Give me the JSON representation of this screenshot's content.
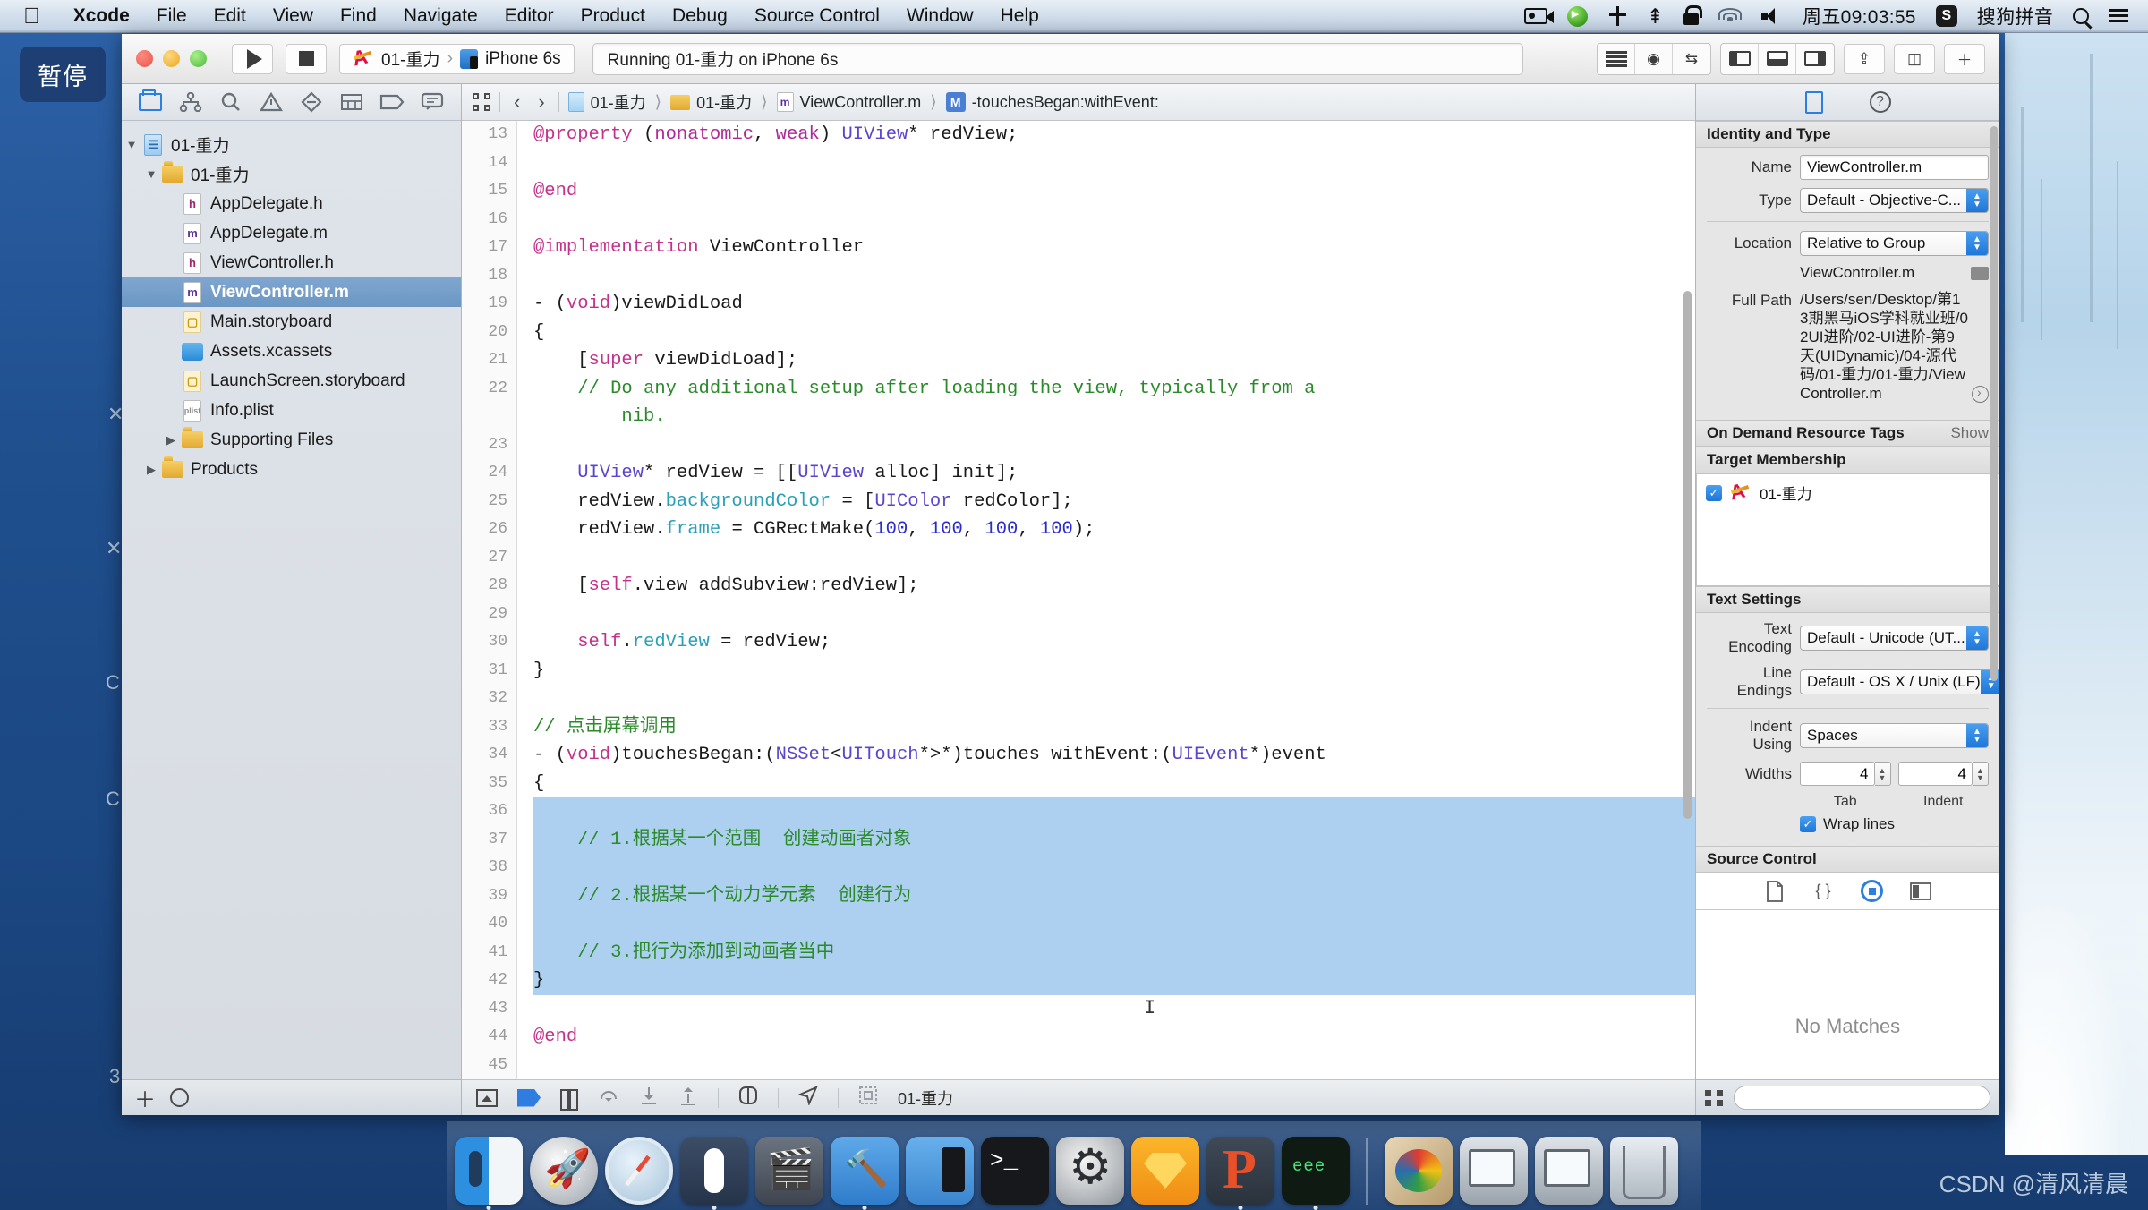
{
  "menubar": {
    "apple_icon": "apple-logo",
    "items": [
      {
        "label": "Xcode",
        "bold": true
      },
      {
        "label": "File",
        "bold": false
      },
      {
        "label": "Edit",
        "bold": false
      },
      {
        "label": "View",
        "bold": false
      },
      {
        "label": "Find",
        "bold": false
      },
      {
        "label": "Navigate",
        "bold": false
      },
      {
        "label": "Editor",
        "bold": false
      },
      {
        "label": "Product",
        "bold": false
      },
      {
        "label": "Debug",
        "bold": false
      },
      {
        "label": "Source Control",
        "bold": false
      },
      {
        "label": "Window",
        "bold": false
      },
      {
        "label": "Help",
        "bold": false
      }
    ],
    "status_icons": [
      "screen-record-icon",
      "green-play-icon",
      "time-machine-icon",
      "bluetooth-icon",
      "lock-icon",
      "wifi-icon",
      "volume-icon"
    ],
    "clock": "周五09:03:55",
    "ime_badge": "S",
    "ime_label": "搜狗拼音",
    "search_icon": "spotlight-search-icon",
    "list_icon": "notification-center-icon"
  },
  "overlay": {
    "pause_label": "暂停"
  },
  "toolbar": {
    "run_icon": "run-play-icon",
    "stop_icon": "stop-square-icon",
    "scheme_project": "01-重力",
    "scheme_separator": "›",
    "scheme_device": "iPhone 6s",
    "activity_status": "Running 01-重力 on iPhone 6s",
    "right_icons": [
      "standard-editor-icon",
      "assistant-editor-icon",
      "version-editor-icon",
      "navigator-panel-icon",
      "debug-panel-icon",
      "utilities-panel-icon",
      "share-icon",
      "organizer-icon",
      "add-icon"
    ]
  },
  "navigator": {
    "tabs": [
      "project-navigator-icon",
      "symbol-navigator-icon",
      "find-navigator-icon",
      "issue-navigator-icon",
      "test-navigator-icon",
      "debug-navigator-icon",
      "breakpoint-navigator-icon",
      "report-navigator-icon"
    ],
    "tree": [
      {
        "label": "01-重力",
        "indent": 0,
        "disclosure": "▼",
        "icon": "project-icon",
        "selected": false
      },
      {
        "label": "01-重力",
        "indent": 1,
        "disclosure": "▼",
        "icon": "folder-icon",
        "selected": false
      },
      {
        "label": "AppDelegate.h",
        "indent": 2,
        "disclosure": "",
        "icon": "header-file-icon",
        "selected": false
      },
      {
        "label": "AppDelegate.m",
        "indent": 2,
        "disclosure": "",
        "icon": "objc-file-icon",
        "selected": false
      },
      {
        "label": "ViewController.h",
        "indent": 2,
        "disclosure": "",
        "icon": "header-file-icon",
        "selected": false
      },
      {
        "label": "ViewController.m",
        "indent": 2,
        "disclosure": "",
        "icon": "objc-file-icon",
        "selected": true
      },
      {
        "label": "Main.storyboard",
        "indent": 2,
        "disclosure": "",
        "icon": "storyboard-icon",
        "selected": false
      },
      {
        "label": "Assets.xcassets",
        "indent": 2,
        "disclosure": "",
        "icon": "xcassets-icon",
        "selected": false
      },
      {
        "label": "LaunchScreen.storyboard",
        "indent": 2,
        "disclosure": "",
        "icon": "storyboard-icon",
        "selected": false
      },
      {
        "label": "Info.plist",
        "indent": 2,
        "disclosure": "",
        "icon": "plist-icon",
        "selected": false
      },
      {
        "label": "Supporting Files",
        "indent": 1,
        "disclosure": "▶",
        "icon": "folder-icon",
        "selected": false
      },
      {
        "label": "Products",
        "indent": 0,
        "disclosure": "▶",
        "icon": "folder-icon",
        "selected": false
      }
    ],
    "bottom_icons": [
      "add-file-icon",
      "filter-icon"
    ]
  },
  "jumpbar": {
    "grid_icon": "related-items-icon",
    "back_label": "‹",
    "forward_label": "›",
    "crumbs": [
      {
        "label": "01-重力",
        "icon": "project-icon"
      },
      {
        "label": "01-重力",
        "icon": "folder-icon"
      },
      {
        "label": "ViewController.m",
        "icon": "objc-file-icon"
      },
      {
        "label": "-touchesBegan:withEvent:",
        "icon": "method-icon"
      }
    ]
  },
  "editor": {
    "first_line": 13,
    "lines": [
      {
        "n": 13,
        "tokens": [
          {
            "t": "@property",
            "c": "kw"
          },
          {
            "t": " (",
            "c": ""
          },
          {
            "t": "nonatomic",
            "c": "kw2"
          },
          {
            "t": ", ",
            "c": ""
          },
          {
            "t": "weak",
            "c": "kw2"
          },
          {
            "t": ") ",
            "c": ""
          },
          {
            "t": "UIView",
            "c": "ty"
          },
          {
            "t": "* redView;",
            "c": ""
          }
        ]
      },
      {
        "n": 14,
        "tokens": []
      },
      {
        "n": 15,
        "tokens": [
          {
            "t": "@end",
            "c": "kw"
          }
        ]
      },
      {
        "n": 16,
        "tokens": []
      },
      {
        "n": 17,
        "tokens": [
          {
            "t": "@implementation",
            "c": "kw"
          },
          {
            "t": " ViewController",
            "c": ""
          }
        ]
      },
      {
        "n": 18,
        "tokens": []
      },
      {
        "n": 19,
        "tokens": [
          {
            "t": "- (",
            "c": ""
          },
          {
            "t": "void",
            "c": "kw"
          },
          {
            "t": ")viewDidLoad",
            "c": ""
          }
        ]
      },
      {
        "n": 20,
        "tokens": [
          {
            "t": "{",
            "c": ""
          }
        ]
      },
      {
        "n": 21,
        "tokens": [
          {
            "t": "    [",
            "c": ""
          },
          {
            "t": "super",
            "c": "kw"
          },
          {
            "t": " viewDidLoad];",
            "c": ""
          }
        ]
      },
      {
        "n": 22,
        "tokens": [
          {
            "t": "    // Do any additional setup after loading the view, typically from a",
            "c": "cm"
          }
        ]
      },
      {
        "n": null,
        "tokens": [
          {
            "t": "        nib.",
            "c": "cm"
          }
        ]
      },
      {
        "n": 23,
        "tokens": []
      },
      {
        "n": 24,
        "tokens": [
          {
            "t": "    ",
            "c": ""
          },
          {
            "t": "UIView",
            "c": "ty"
          },
          {
            "t": "* redView = [[",
            "c": ""
          },
          {
            "t": "UIView",
            "c": "ty"
          },
          {
            "t": " alloc] init];",
            "c": ""
          }
        ]
      },
      {
        "n": 25,
        "tokens": [
          {
            "t": "    redView.",
            "c": ""
          },
          {
            "t": "backgroundColor",
            "c": "pr"
          },
          {
            "t": " = [",
            "c": ""
          },
          {
            "t": "UIColor",
            "c": "ty"
          },
          {
            "t": " redColor];",
            "c": ""
          }
        ]
      },
      {
        "n": 26,
        "tokens": [
          {
            "t": "    redView.",
            "c": ""
          },
          {
            "t": "frame",
            "c": "pr"
          },
          {
            "t": " = CGRectMake(",
            "c": ""
          },
          {
            "t": "100",
            "c": "nm"
          },
          {
            "t": ", ",
            "c": ""
          },
          {
            "t": "100",
            "c": "nm"
          },
          {
            "t": ", ",
            "c": ""
          },
          {
            "t": "100",
            "c": "nm"
          },
          {
            "t": ", ",
            "c": ""
          },
          {
            "t": "100",
            "c": "nm"
          },
          {
            "t": ");",
            "c": ""
          }
        ]
      },
      {
        "n": 27,
        "tokens": []
      },
      {
        "n": 28,
        "tokens": [
          {
            "t": "    [",
            "c": ""
          },
          {
            "t": "self",
            "c": "kw"
          },
          {
            "t": ".view addSubview:redView];",
            "c": ""
          }
        ]
      },
      {
        "n": 29,
        "tokens": []
      },
      {
        "n": 30,
        "tokens": [
          {
            "t": "    ",
            "c": ""
          },
          {
            "t": "self",
            "c": "kw"
          },
          {
            "t": ".",
            "c": ""
          },
          {
            "t": "redView",
            "c": "pr"
          },
          {
            "t": " = redView;",
            "c": ""
          }
        ]
      },
      {
        "n": 31,
        "tokens": [
          {
            "t": "}",
            "c": ""
          }
        ]
      },
      {
        "n": 32,
        "tokens": []
      },
      {
        "n": 33,
        "tokens": [
          {
            "t": "// 点击屏幕调用",
            "c": "cm"
          }
        ]
      },
      {
        "n": 34,
        "tokens": [
          {
            "t": "- (",
            "c": ""
          },
          {
            "t": "void",
            "c": "kw"
          },
          {
            "t": ")touchesBegan:(",
            "c": ""
          },
          {
            "t": "NSSet",
            "c": "ty"
          },
          {
            "t": "<",
            "c": ""
          },
          {
            "t": "UITouch",
            "c": "ty"
          },
          {
            "t": "*>*)touches withEvent:(",
            "c": ""
          },
          {
            "t": "UIEvent",
            "c": "ty"
          },
          {
            "t": "*)event",
            "c": ""
          }
        ]
      },
      {
        "n": 35,
        "tokens": [
          {
            "t": "{",
            "c": ""
          }
        ]
      },
      {
        "n": 36,
        "tokens": [],
        "highlight": true
      },
      {
        "n": 37,
        "tokens": [
          {
            "t": "    // 1.根据某一个范围  创建动画者对象",
            "c": "cm"
          }
        ],
        "highlight": true
      },
      {
        "n": 38,
        "tokens": [],
        "highlight": true
      },
      {
        "n": 39,
        "tokens": [
          {
            "t": "    // 2.根据某一个动力学元素  创建行为",
            "c": "cm"
          }
        ],
        "highlight": true
      },
      {
        "n": 40,
        "tokens": [],
        "highlight": true
      },
      {
        "n": 41,
        "tokens": [
          {
            "t": "    // 3.把行为添加到动画者当中",
            "c": "cm"
          }
        ],
        "highlight": true
      },
      {
        "n": 42,
        "tokens": [
          {
            "t": "}",
            "c": ""
          }
        ],
        "highlight": true
      },
      {
        "n": 43,
        "tokens": []
      },
      {
        "n": 44,
        "tokens": [
          {
            "t": "@end",
            "c": "kw"
          }
        ]
      },
      {
        "n": 45,
        "tokens": []
      }
    ],
    "selection_color": "#aed0f0",
    "bottom_bar": {
      "icons": [
        "show-debug-area-icon",
        "breakpoint-flag-icon",
        "pause-icon",
        "step-over-icon",
        "step-into-icon",
        "step-out-icon",
        "view-debug-icon",
        "location-icon",
        "memory-graph-icon"
      ],
      "target_label": "01-重力"
    }
  },
  "inspector": {
    "tabs": [
      "file-inspector-icon",
      "quick-help-icon"
    ],
    "identity": {
      "header": "Identity and Type",
      "name_label": "Name",
      "name_value": "ViewController.m",
      "type_label": "Type",
      "type_value": "Default - Objective-C...",
      "location_label": "Location",
      "location_value": "Relative to Group",
      "location_file": "ViewController.m",
      "full_path_label": "Full Path",
      "full_path_value": "/Users/sen/Desktop/第13期黑马iOS学科就业班/02UI进阶/02-UI进阶-第9天(UIDynamic)/04-源代码/01-重力/01-重力/ViewController.m"
    },
    "on_demand": {
      "header": "On Demand Resource Tags",
      "show_label": "Show"
    },
    "target_membership": {
      "header": "Target Membership",
      "checked": true,
      "target_name": "01-重力",
      "check_glyph": "✓"
    },
    "text_settings": {
      "header": "Text Settings",
      "encoding_label": "Text Encoding",
      "encoding_value": "Default - Unicode (UT...",
      "line_endings_label": "Line Endings",
      "line_endings_value": "Default - OS X / Unix (LF)",
      "indent_label": "Indent Using",
      "indent_value": "Spaces",
      "widths_label": "Widths",
      "tab_value": "4",
      "indent_value_num": "4",
      "tab_caption": "Tab",
      "indent_caption": "Indent",
      "wrap_lines_label": "Wrap lines",
      "wrap_lines_checked": true
    },
    "source_control": {
      "header": "Source Control",
      "icons": [
        "file-icon",
        "braces-icon",
        "target-selected-icon",
        "split-icon"
      ],
      "empty_message": "No Matches"
    },
    "bottom_icons": [
      "grid-icon"
    ],
    "search_placeholder": ""
  },
  "dock": {
    "items": [
      {
        "name": "finder",
        "running": true
      },
      {
        "name": "launchpad",
        "running": false
      },
      {
        "name": "safari",
        "running": false
      },
      {
        "name": "mouse-app",
        "running": true
      },
      {
        "name": "imovie",
        "running": false
      },
      {
        "name": "xcode",
        "running": true
      },
      {
        "name": "xcode-simulator",
        "running": false
      },
      {
        "name": "terminal",
        "running": false
      },
      {
        "name": "system-preferences",
        "running": false
      },
      {
        "name": "sketch",
        "running": false
      },
      {
        "name": "php-storm",
        "running": true
      },
      {
        "name": "console",
        "running": true
      }
    ],
    "recent": [
      {
        "name": "picture-viewer"
      },
      {
        "name": "display-1"
      },
      {
        "name": "display-2"
      },
      {
        "name": "trash"
      }
    ]
  },
  "watermark": {
    "text": "CSDN @清风清晨"
  },
  "colors": {
    "accent_blue": "#2a7fe0",
    "selection_blue": "#aed0f0",
    "desktop_blue": "#1d4a8c",
    "comment_green": "#2a8a2a",
    "keyword_pink": "#c5308a"
  }
}
